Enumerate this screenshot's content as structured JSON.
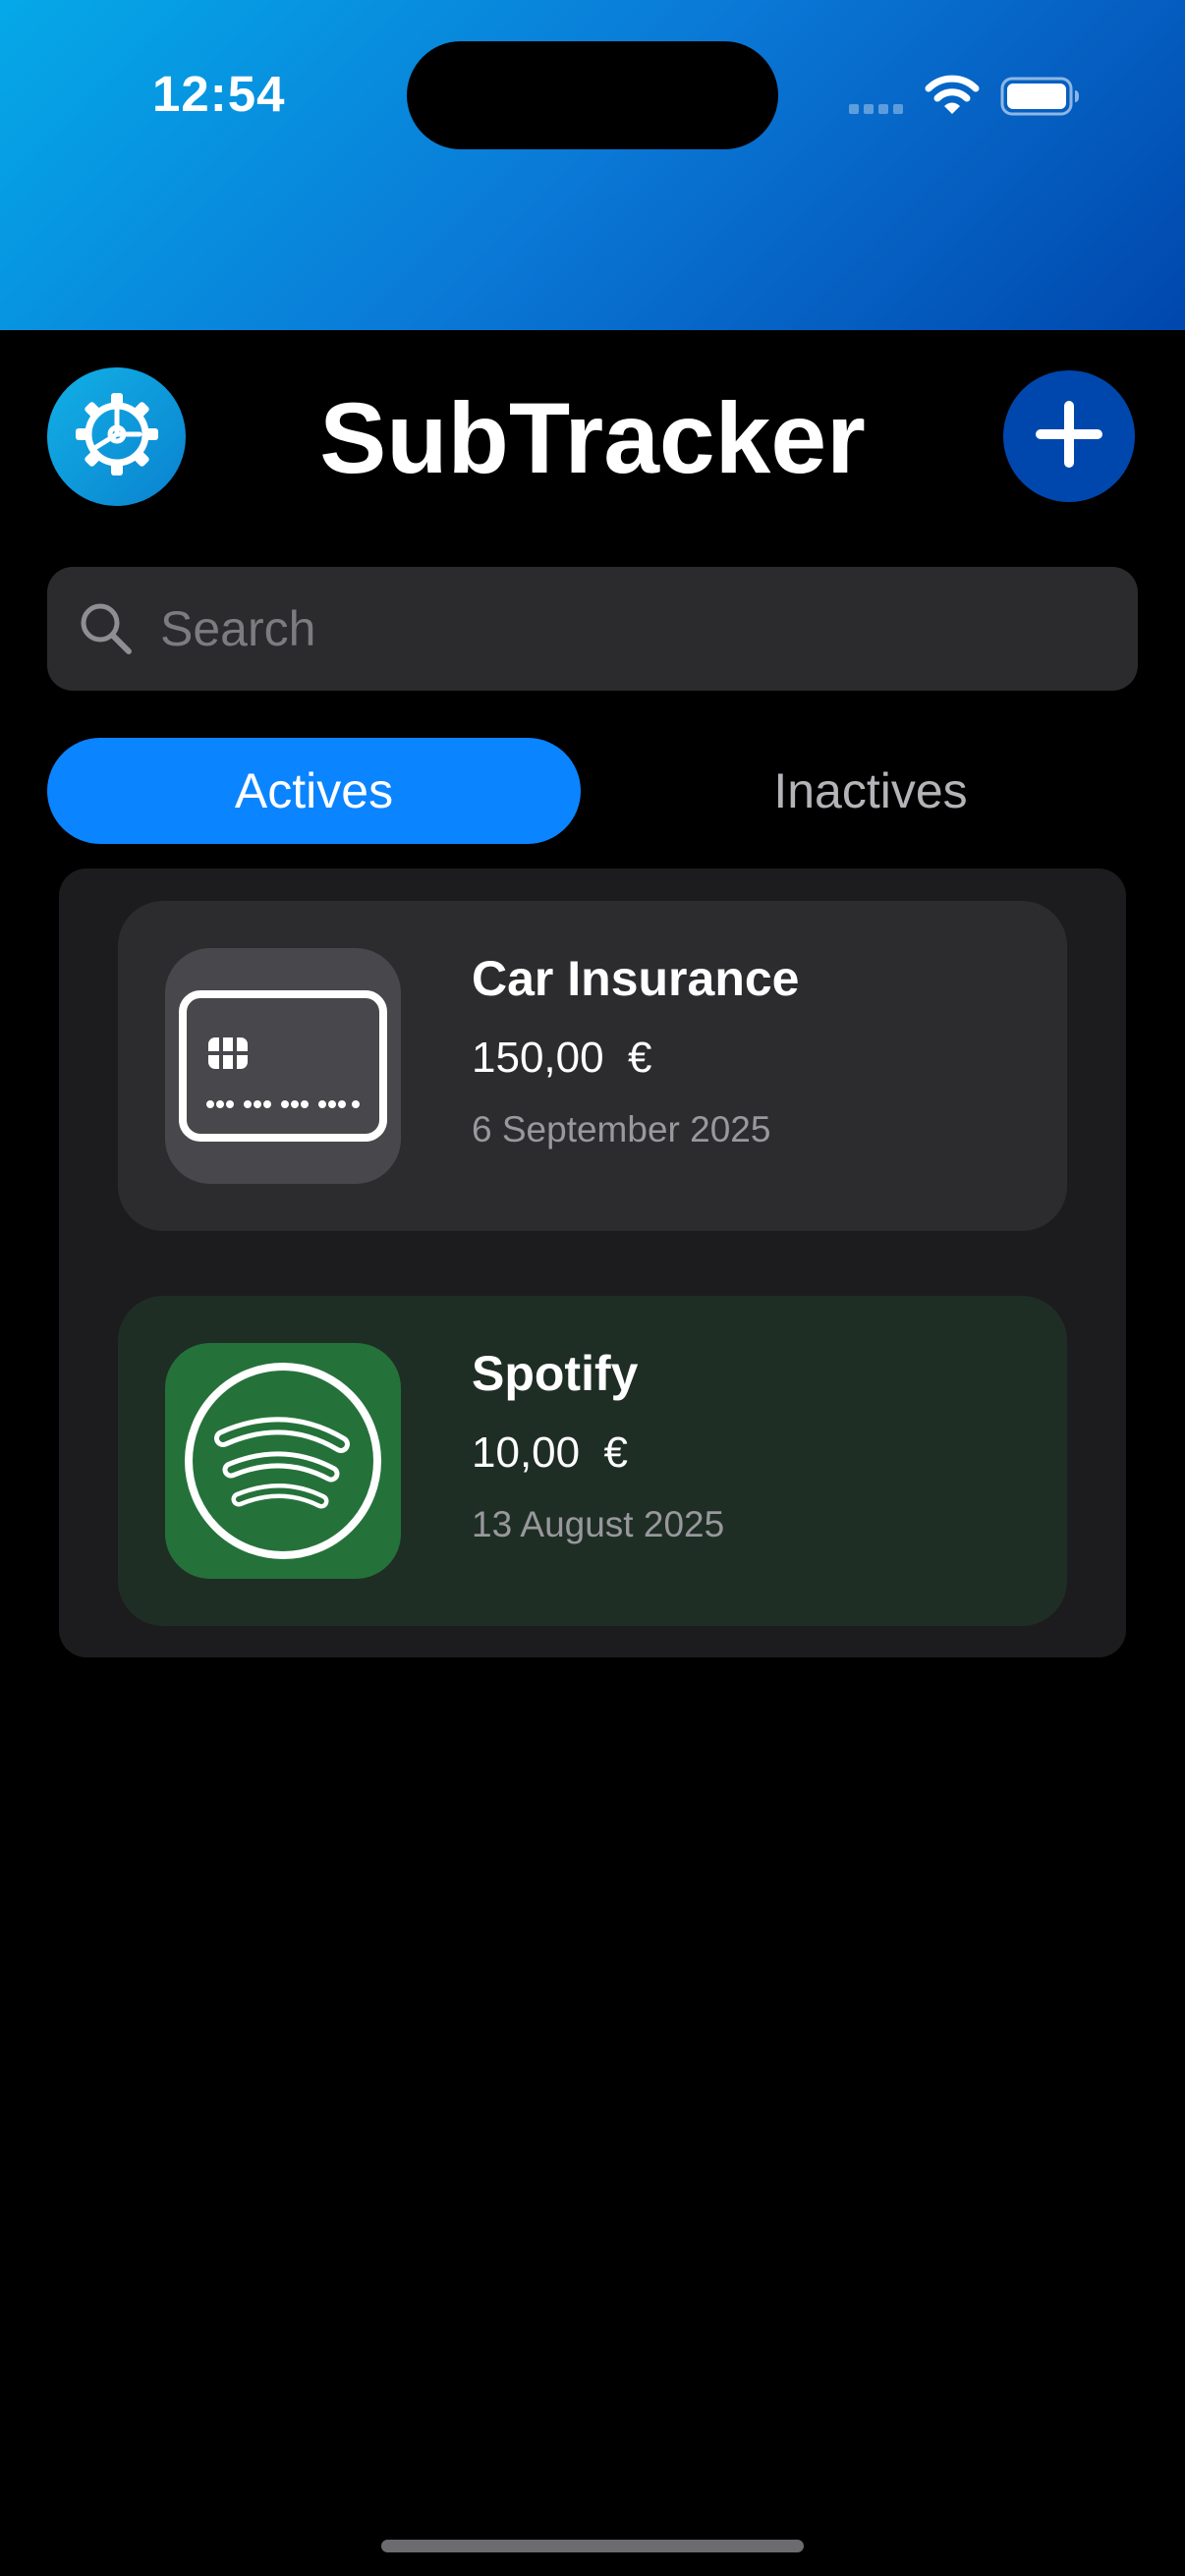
{
  "status_bar": {
    "time": "12:54",
    "icons": [
      "cellular-signal-icon",
      "wifi-icon",
      "battery-icon"
    ]
  },
  "header": {
    "title": "SubTracker",
    "settings_icon": "gear-icon",
    "add_icon": "plus-icon"
  },
  "search": {
    "placeholder": "Search",
    "value": ""
  },
  "tabs": [
    {
      "label": "Actives",
      "selected": true
    },
    {
      "label": "Inactives",
      "selected": false
    }
  ],
  "subscriptions": [
    {
      "name": "Car Insurance",
      "price": "150,00  €",
      "date": "6 September 2025",
      "icon": "credit-card-icon",
      "card_color": "#2c2c2e",
      "icon_color": "#48484c"
    },
    {
      "name": "Spotify",
      "price": "10,00  €",
      "date": "13 August 2025",
      "icon": "spotify-icon",
      "card_color": "#1f2e25",
      "icon_color": "#24723a"
    }
  ],
  "colors": {
    "accent": "#0b84ff",
    "add_button": "#0047ad",
    "background": "#000000"
  }
}
